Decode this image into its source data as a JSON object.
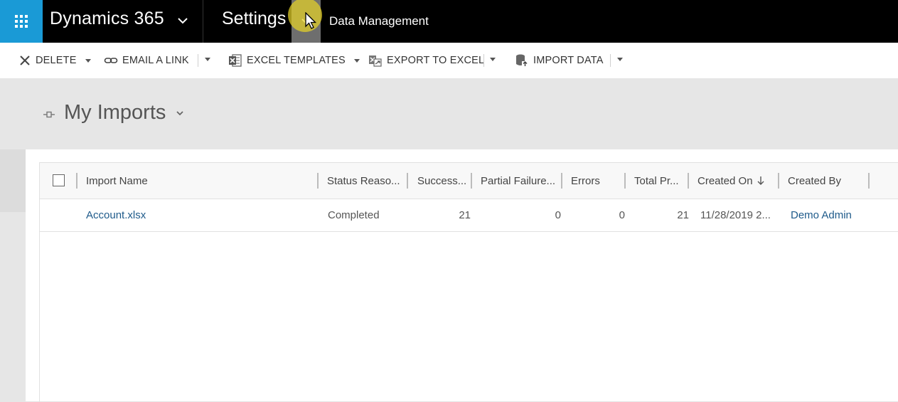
{
  "topbar": {
    "app_title": "Dynamics 365",
    "area_title": "Settings",
    "breadcrumb": "Data Management",
    "brand_color": "#1a9ad6"
  },
  "commands": {
    "delete": "DELETE",
    "email_link": "EMAIL A LINK",
    "excel_templates": "EXCEL TEMPLATES",
    "export_excel": "EXPORT TO EXCEL",
    "import_data": "IMPORT DATA"
  },
  "view": {
    "title": "My Imports"
  },
  "grid": {
    "columns": [
      "Import Name",
      "Status Reaso...",
      "Success...",
      "Partial Failure...",
      "Errors",
      "Total Pr...",
      "Created On",
      "Created By"
    ],
    "sorted_column": "Created On",
    "sort_direction": "descending",
    "rows": [
      {
        "import_name": "Account.xlsx",
        "status_reason": "Completed",
        "successes": "21",
        "partial_failures": "0",
        "errors": "0",
        "total_processed": "21",
        "created_on": "11/28/2019 2...",
        "created_by": "Demo Admin"
      }
    ]
  }
}
